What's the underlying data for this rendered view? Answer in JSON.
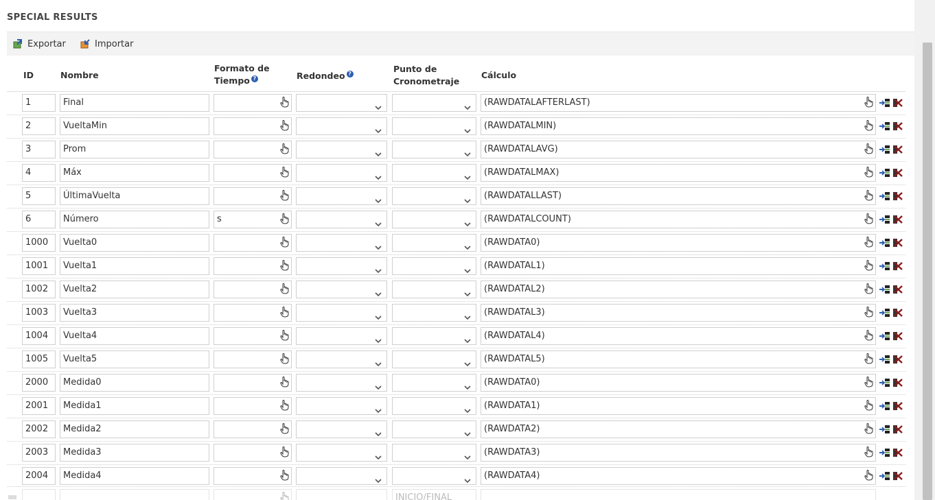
{
  "section_title": "SPECIAL RESULTS",
  "toolbar": {
    "export_label": "Exportar",
    "import_label": "Importar"
  },
  "columns": {
    "id": "ID",
    "name": "Nombre",
    "format_line1": "Formato de",
    "format_line2": "Tiempo",
    "rounding": "Redondeo",
    "point_line1": "Punto de",
    "point_line2": "Cronometraje",
    "calc": "Cálculo"
  },
  "help_icon": "?",
  "rows": [
    {
      "id": "1",
      "name": "Final",
      "format": "",
      "calc": "(RAWDATALAFTERLAST)"
    },
    {
      "id": "2",
      "name": "VueltaMin",
      "format": "",
      "calc": "(RAWDATALMIN)"
    },
    {
      "id": "3",
      "name": "Prom",
      "format": "",
      "calc": "(RAWDATALAVG)"
    },
    {
      "id": "4",
      "name": "Máx",
      "format": "",
      "calc": "(RAWDATALMAX)"
    },
    {
      "id": "5",
      "name": "ÚltimaVuelta",
      "format": "",
      "calc": "(RAWDATALLAST)"
    },
    {
      "id": "6",
      "name": "Número",
      "format": "s",
      "calc": "(RAWDATALCOUNT)"
    },
    {
      "id": "1000",
      "name": "Vuelta0",
      "format": "",
      "calc": "(RAWDATA0)"
    },
    {
      "id": "1001",
      "name": "Vuelta1",
      "format": "",
      "calc": "(RAWDATAL1)"
    },
    {
      "id": "1002",
      "name": "Vuelta2",
      "format": "",
      "calc": "(RAWDATAL2)"
    },
    {
      "id": "1003",
      "name": "Vuelta3",
      "format": "",
      "calc": "(RAWDATAL3)"
    },
    {
      "id": "1004",
      "name": "Vuelta4",
      "format": "",
      "calc": "(RAWDATAL4)"
    },
    {
      "id": "1005",
      "name": "Vuelta5",
      "format": "",
      "calc": "(RAWDATAL5)"
    },
    {
      "id": "2000",
      "name": "Medida0",
      "format": "",
      "calc": "(RAWDATA0)"
    },
    {
      "id": "2001",
      "name": "Medida1",
      "format": "",
      "calc": "(RAWDATA1)"
    },
    {
      "id": "2002",
      "name": "Medida2",
      "format": "",
      "calc": "(RAWDATA2)"
    },
    {
      "id": "2003",
      "name": "Medida3",
      "format": "",
      "calc": "(RAWDATA3)"
    },
    {
      "id": "2004",
      "name": "Medida4",
      "format": "",
      "calc": "(RAWDATA4)"
    }
  ],
  "new_row": {
    "point_value": "INICIO/FINAL"
  },
  "icons": {
    "export": "export-icon",
    "import": "import-icon",
    "hand": "hand-pointer-icon",
    "chevron": "chevron-down-icon",
    "insert": "insert-row-icon",
    "delete": "delete-row-icon",
    "help": "help-icon"
  },
  "colors": {
    "help_blue": "#2a5db0",
    "delete_red": "#8b1a1a",
    "toolbar_bg": "#f3f3f3"
  }
}
